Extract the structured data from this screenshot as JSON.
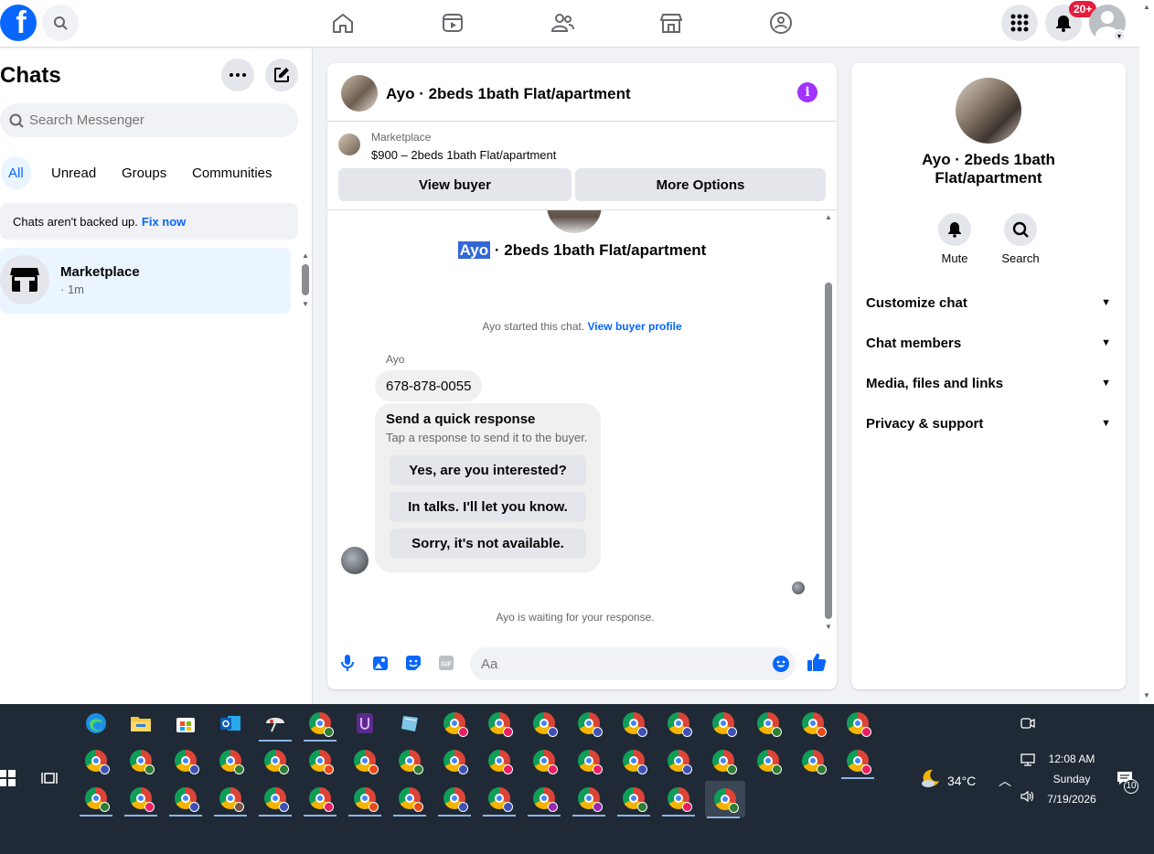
{
  "topnav": {
    "logo": "f",
    "notif_badge": "20+"
  },
  "left": {
    "title": "Chats",
    "search_placeholder": "Search Messenger",
    "tabs": [
      {
        "label": "All",
        "active": true
      },
      {
        "label": "Unread",
        "active": false
      },
      {
        "label": "Groups",
        "active": false
      },
      {
        "label": "Communities",
        "active": false
      }
    ],
    "backup_text": "Chats aren't backed up.",
    "backup_link": "Fix now",
    "chat_item": {
      "name": "Marketplace",
      "time": "· 1m"
    }
  },
  "chat": {
    "header_title": "Ayo · 2beds 1bath Flat/apartment",
    "marketplace_label": "Marketplace",
    "listing": "$900 – 2beds 1bath Flat/apartment",
    "view_buyer": "View buyer",
    "more_options": "More Options",
    "title_highlight": "Ayo",
    "title_rest": " · 2beds 1bath Flat/apartment",
    "started_text": "Ayo started this chat.",
    "started_link": "View buyer profile",
    "sender": "Ayo",
    "phone": "678-878-0055",
    "quick_title": "Send a quick response",
    "quick_sub": "Tap a response to send it to the buyer.",
    "quick_responses": [
      "Yes, are you interested?",
      "In talks. I'll let you know.",
      "Sorry, it's not available."
    ],
    "waiting": "Ayo is waiting for your response.",
    "input_placeholder": "Aa"
  },
  "right": {
    "title_line1": "Ayo · 2beds 1bath",
    "title_line2": "Flat/apartment",
    "mute": "Mute",
    "search": "Search",
    "sections": [
      "Customize chat",
      "Chat members",
      "Media, files and links",
      "Privacy & support"
    ]
  },
  "taskbar": {
    "weather": "34°C",
    "time": "12:08 AM",
    "day": "Sunday",
    "date": "7/19/2026",
    "notif_count": "10"
  },
  "colors": {
    "accent": "#0866ff",
    "info": "#a033ff",
    "taskbar": "#1f2a36"
  }
}
